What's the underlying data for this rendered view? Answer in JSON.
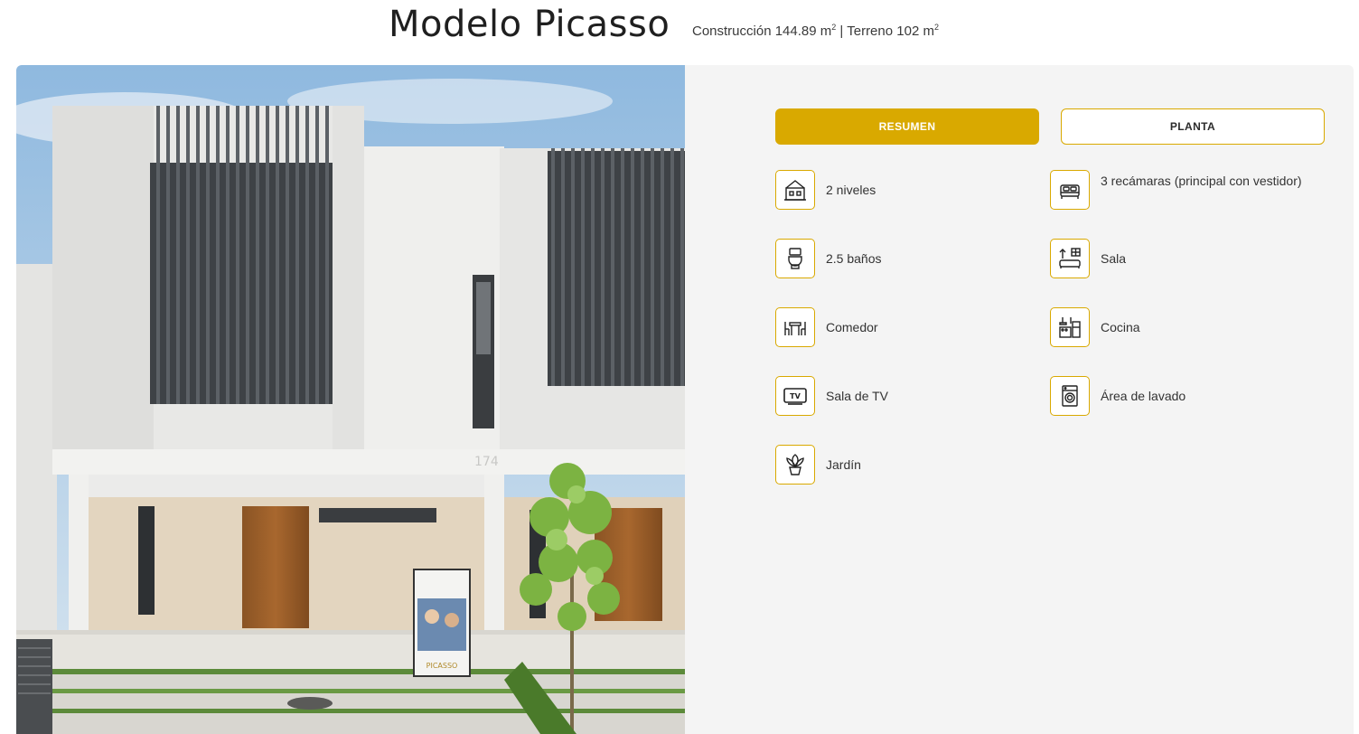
{
  "header": {
    "title": "Modelo Picasso",
    "specs_prefix": "Construcción 144.89 m",
    "specs_mid": " | Terreno 102 m",
    "sup": "2"
  },
  "photo": {
    "house_number": "174",
    "sign_text": "PICASSO"
  },
  "tabs": [
    {
      "label": "RESUMEN",
      "active": true
    },
    {
      "label": "PLANTA",
      "active": false
    }
  ],
  "features": [
    {
      "label": "2 niveles",
      "icon": "building-levels-icon"
    },
    {
      "label": "3 recámaras (principal con vestidor)",
      "icon": "bed-icon"
    },
    {
      "label": "2.5 baños",
      "icon": "toilet-icon"
    },
    {
      "label": "Sala",
      "icon": "living-room-icon"
    },
    {
      "label": "Comedor",
      "icon": "dining-table-icon"
    },
    {
      "label": "Cocina",
      "icon": "kitchen-icon"
    },
    {
      "label": "Sala de TV",
      "icon": "tv-icon"
    },
    {
      "label": "Área de lavado",
      "icon": "washing-machine-icon"
    },
    {
      "label": "Jardín",
      "icon": "plant-icon"
    }
  ],
  "colors": {
    "accent": "#d9a900",
    "panel_bg": "#f4f4f4"
  }
}
